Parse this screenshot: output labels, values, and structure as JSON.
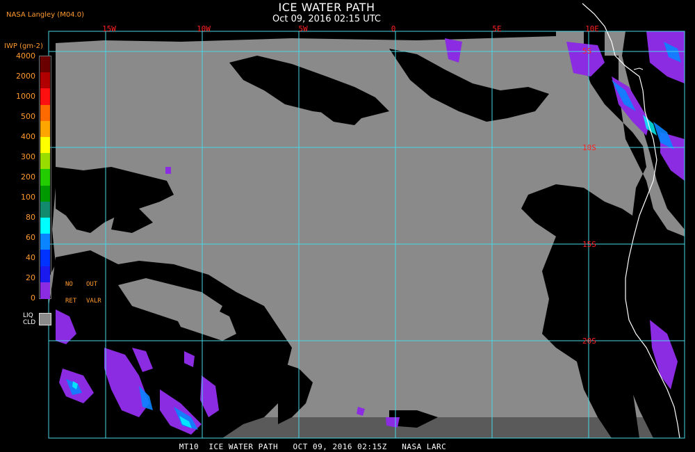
{
  "header": {
    "title": "ICE WATER PATH",
    "subtitle": "Oct 09, 2016 02:15 UTC",
    "provider": "NASA Langley (M04.0)"
  },
  "legend": {
    "unit_label": "IWP (gm-2)",
    "ticks": [
      "4000",
      "2000",
      "1000",
      "500",
      "400",
      "300",
      "200",
      "100",
      "80",
      "60",
      "40",
      "20",
      "0"
    ],
    "colors": [
      "#6b0000",
      "#b00000",
      "#ff1010",
      "#ff6a00",
      "#ffa500",
      "#ffff00",
      "#99dd00",
      "#22cc00",
      "#009900",
      "#128a6e",
      "#00ffff",
      "#0a84ff",
      "#0033ff",
      "#1a1aee",
      "#8b2be2"
    ],
    "no_ret": [
      "NO",
      "RET"
    ],
    "out_valr": [
      "OUT",
      "VALR"
    ],
    "liquid_cloud": [
      "LIQ",
      "CLD"
    ],
    "liquid_cloud_color": "#8a8a8a"
  },
  "grid": {
    "color": "#48d8e8",
    "longitudes": [
      "15W",
      "10W",
      "5W",
      "0",
      "5E",
      "10E"
    ],
    "latitudes": [
      "5S",
      "10S",
      "15S",
      "20S"
    ]
  },
  "colors": {
    "background": "#000000",
    "clear_sky": "#8a8a8a",
    "ice": "#8b2be2",
    "coastline": "#ffffff",
    "grid_label": "#ff2020",
    "legend_text": "#ff9a2e"
  },
  "footer": {
    "text": "MT10  ICE WATER PATH   OCT 09, 2016 02:15Z   NASA LARC"
  }
}
